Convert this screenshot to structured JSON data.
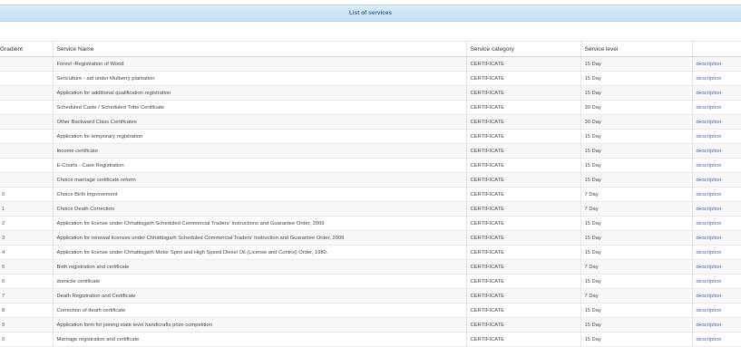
{
  "title": "List of services",
  "columns": {
    "gradient": "Gradient",
    "service_name": "Service Name",
    "service_category": "Service category",
    "service_level": "Service level"
  },
  "rows": [
    {
      "num": "",
      "name": "Forest -Registration of Wood",
      "category": "CERTIFICATE",
      "level": "15 Day",
      "action": "description"
    },
    {
      "num": "",
      "name": "Sericulture - aid under Mulberry plantation",
      "category": "CERTIFICATE",
      "level": "15 Day",
      "action": "description"
    },
    {
      "num": "",
      "name": "Application for additional qualification registration",
      "category": "CERTIFICATE",
      "level": "15 Day",
      "action": "description"
    },
    {
      "num": "",
      "name": "Scheduled Caste / Scheduled Tribe Certificate",
      "category": "CERTIFICATE",
      "level": "30 Day",
      "action": "description"
    },
    {
      "num": "",
      "name": "Other Backward Class Certificates",
      "category": "CERTIFICATE",
      "level": "30 Day",
      "action": "description"
    },
    {
      "num": "",
      "name": "Application for temporary registration",
      "category": "CERTIFICATE",
      "level": "15 Day",
      "action": "description"
    },
    {
      "num": "",
      "name": "Income certificate",
      "category": "CERTIFICATE",
      "level": "15 Day",
      "action": "description"
    },
    {
      "num": "",
      "name": "E-Courts - Case Registration",
      "category": "CERTIFICATE",
      "level": "15 Day",
      "action": "description"
    },
    {
      "num": "",
      "name": "Choice marriage certificate reform",
      "category": "CERTIFICATE",
      "level": "15 Day",
      "action": "description"
    },
    {
      "num": "0",
      "name": "Choice Birth Improvement",
      "category": "CERTIFICATE",
      "level": "7 Day",
      "action": "description"
    },
    {
      "num": "1",
      "name": "Choice Death Correction",
      "category": "CERTIFICATE",
      "level": "7 Day",
      "action": "description"
    },
    {
      "num": "2",
      "name": "Application for license under Chhattisgarh Scheduled Commercial Traders' Instructions and Guarantee Order, 2009",
      "category": "CERTIFICATE",
      "level": "15 Day",
      "action": "description"
    },
    {
      "num": "3",
      "name": "Application for renewal licenses under Chhattisgarh Scheduled Commercial Traders' Instruction and Guarantee Order, 2009",
      "category": "CERTIFICATE",
      "level": "15 Day",
      "action": "description"
    },
    {
      "num": "4",
      "name": "Application for license under Chhattisgarh Motor Spirit and High Speed Diesel Oil (License and Control) Order, 1980.",
      "category": "CERTIFICATE",
      "level": "15 Day",
      "action": "description"
    },
    {
      "num": "5",
      "name": "Birth registration and certificate",
      "category": "CERTIFICATE",
      "level": "7 Day",
      "action": "description"
    },
    {
      "num": "6",
      "name": "domicile certificate",
      "category": "CERTIFICATE",
      "level": "15 Day",
      "action": "description"
    },
    {
      "num": "7",
      "name": "Death Registration and Certificate",
      "category": "CERTIFICATE",
      "level": "7 Day",
      "action": "description"
    },
    {
      "num": "8",
      "name": "Correction of death certificate",
      "category": "CERTIFICATE",
      "level": "15 Day",
      "action": "description"
    },
    {
      "num": "9",
      "name": "Application form for joining state level handicrafts prize competition",
      "category": "CERTIFICATE",
      "level": "15 Day",
      "action": "description"
    },
    {
      "num": "0",
      "name": "Marriage registration and certificate",
      "category": "CERTIFICATE",
      "level": "15 Day",
      "action": "description"
    }
  ]
}
